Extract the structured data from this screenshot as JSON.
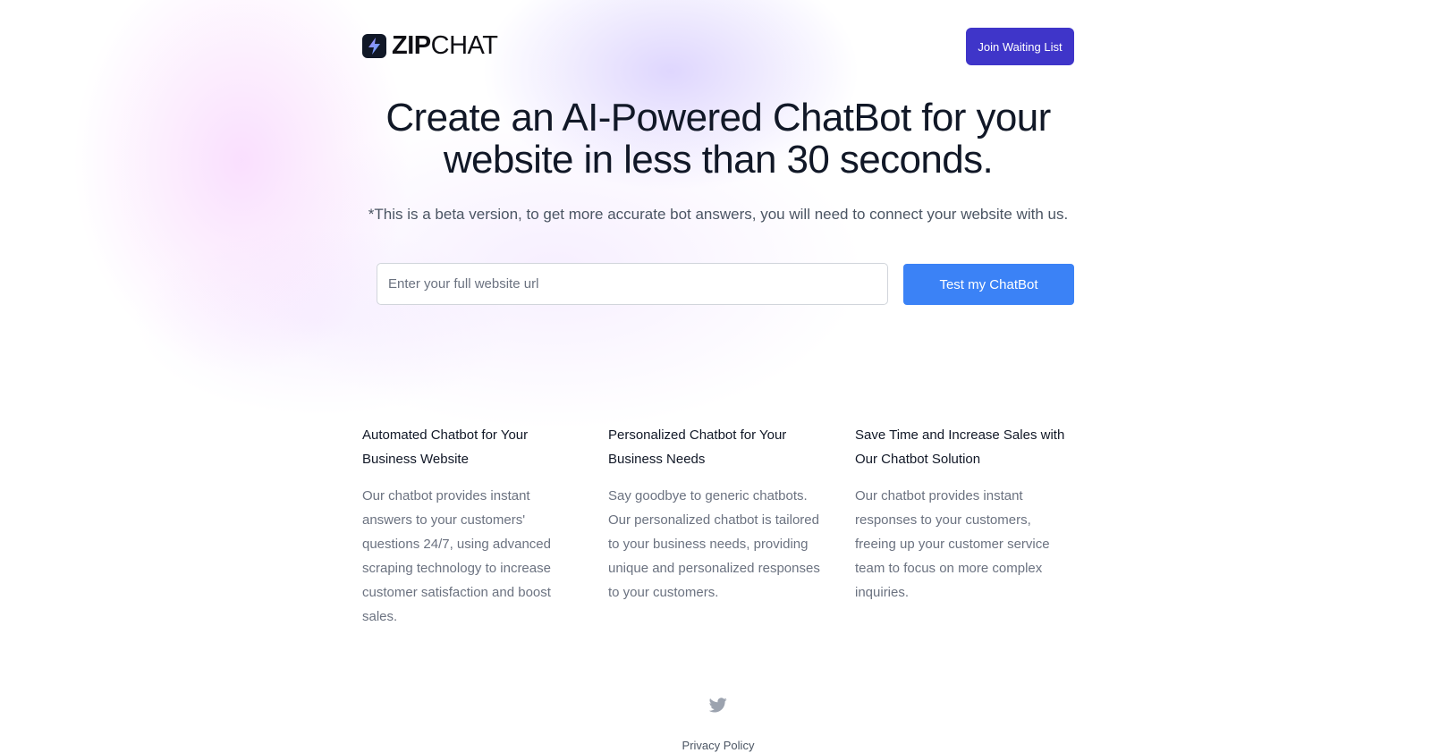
{
  "brand": {
    "name_bold": "ZIP",
    "name_light": "CHAT",
    "logo_icon": "lightning-bolt-icon"
  },
  "header": {
    "join_label": "Join Waiting List"
  },
  "hero": {
    "title_line1": "Create an AI-Powered ChatBot for your",
    "title_line2": "website in less than 30 seconds.",
    "subtitle": "*This is a beta version, to get more accurate bot answers, you will need to connect your website with us."
  },
  "form": {
    "url_placeholder": "Enter your full website url",
    "url_value": "",
    "submit_label": "Test my ChatBot"
  },
  "features": [
    {
      "title": "Automated Chatbot for Your Business Website",
      "body": "Our chatbot provides instant answers to your customers' questions 24/7, using advanced scraping technology to increase customer satisfaction and boost sales."
    },
    {
      "title": "Personalized Chatbot for Your Business Needs",
      "body": "Say goodbye to generic chatbots. Our personalized chatbot is tailored to your business needs, providing unique and personalized responses to your customers."
    },
    {
      "title": "Save Time and Increase Sales with Our Chatbot Solution",
      "body": "Our chatbot provides instant responses to your customers, freeing up your customer service team to focus on more complex inquiries."
    }
  ],
  "footer": {
    "social_icon": "twitter-icon",
    "privacy_label": "Privacy Policy"
  },
  "colors": {
    "primary_button": "#3f35c9",
    "accent_button": "#3b82f6",
    "text_dark": "#111827",
    "text_muted": "#6b7280"
  }
}
